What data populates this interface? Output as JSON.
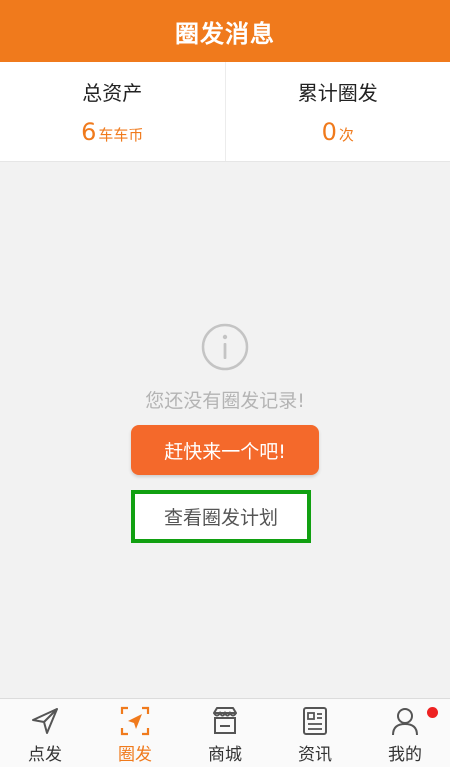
{
  "header": {
    "title": "圈发消息"
  },
  "stats": {
    "total_assets": {
      "label": "总资产",
      "value": "6",
      "unit": "车车币"
    },
    "total_shares": {
      "label": "累计圈发",
      "value": "0",
      "unit": "次"
    }
  },
  "empty_state": {
    "icon": "info-circle-icon",
    "message": "您还没有圈发记录!",
    "cta_label": "赶快来一个吧!",
    "plan_link_label": "查看圈发计划"
  },
  "tabbar": {
    "items": [
      {
        "label": "点发",
        "icon": "paper-plane-icon",
        "active": false
      },
      {
        "label": "圈发",
        "icon": "framed-plane-icon",
        "active": true
      },
      {
        "label": "商城",
        "icon": "shop-icon",
        "active": false
      },
      {
        "label": "资讯",
        "icon": "news-icon",
        "active": false
      },
      {
        "label": "我的",
        "icon": "person-icon",
        "active": false,
        "badge": true
      }
    ]
  },
  "colors": {
    "brand_orange": "#f07a1c",
    "cta_orange": "#f4692b",
    "highlight_green": "#11a011",
    "badge_red": "#ee2222"
  }
}
